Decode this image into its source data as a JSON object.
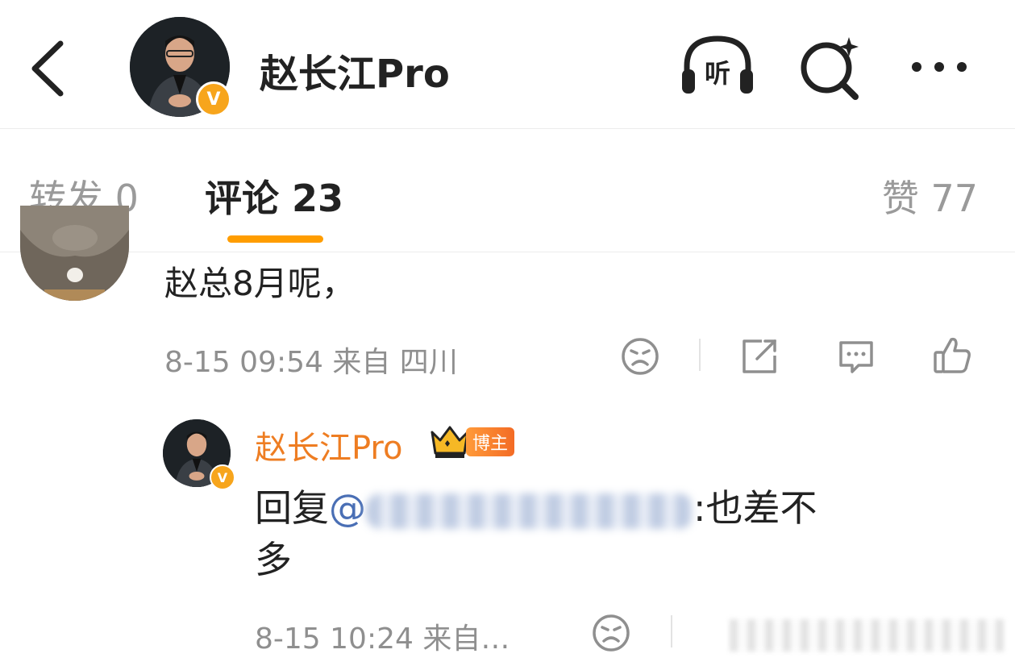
{
  "header": {
    "title": "赵长江Pro",
    "verified_badge": "V",
    "listen_icon_label": "听"
  },
  "tabs": {
    "repost": "转发 0",
    "comments": "评论 23",
    "likes": "赞 77",
    "active": "comments"
  },
  "comment": {
    "text": "赵总8月呢，",
    "meta": "8-15 09:54 来自 四川"
  },
  "reply": {
    "author": "赵长江Pro",
    "badge": "博主",
    "prefix": "回复",
    "mention": "@",
    "suffix": ":也差不",
    "line2": "多",
    "meta": "8-15 10:24 来自…",
    "verified_badge": "V"
  },
  "colors": {
    "accent": "#ff9d00",
    "name_orange": "#ee7d22",
    "mention_blue": "#4a6fb5",
    "meta_gray": "#8f8f8f"
  }
}
